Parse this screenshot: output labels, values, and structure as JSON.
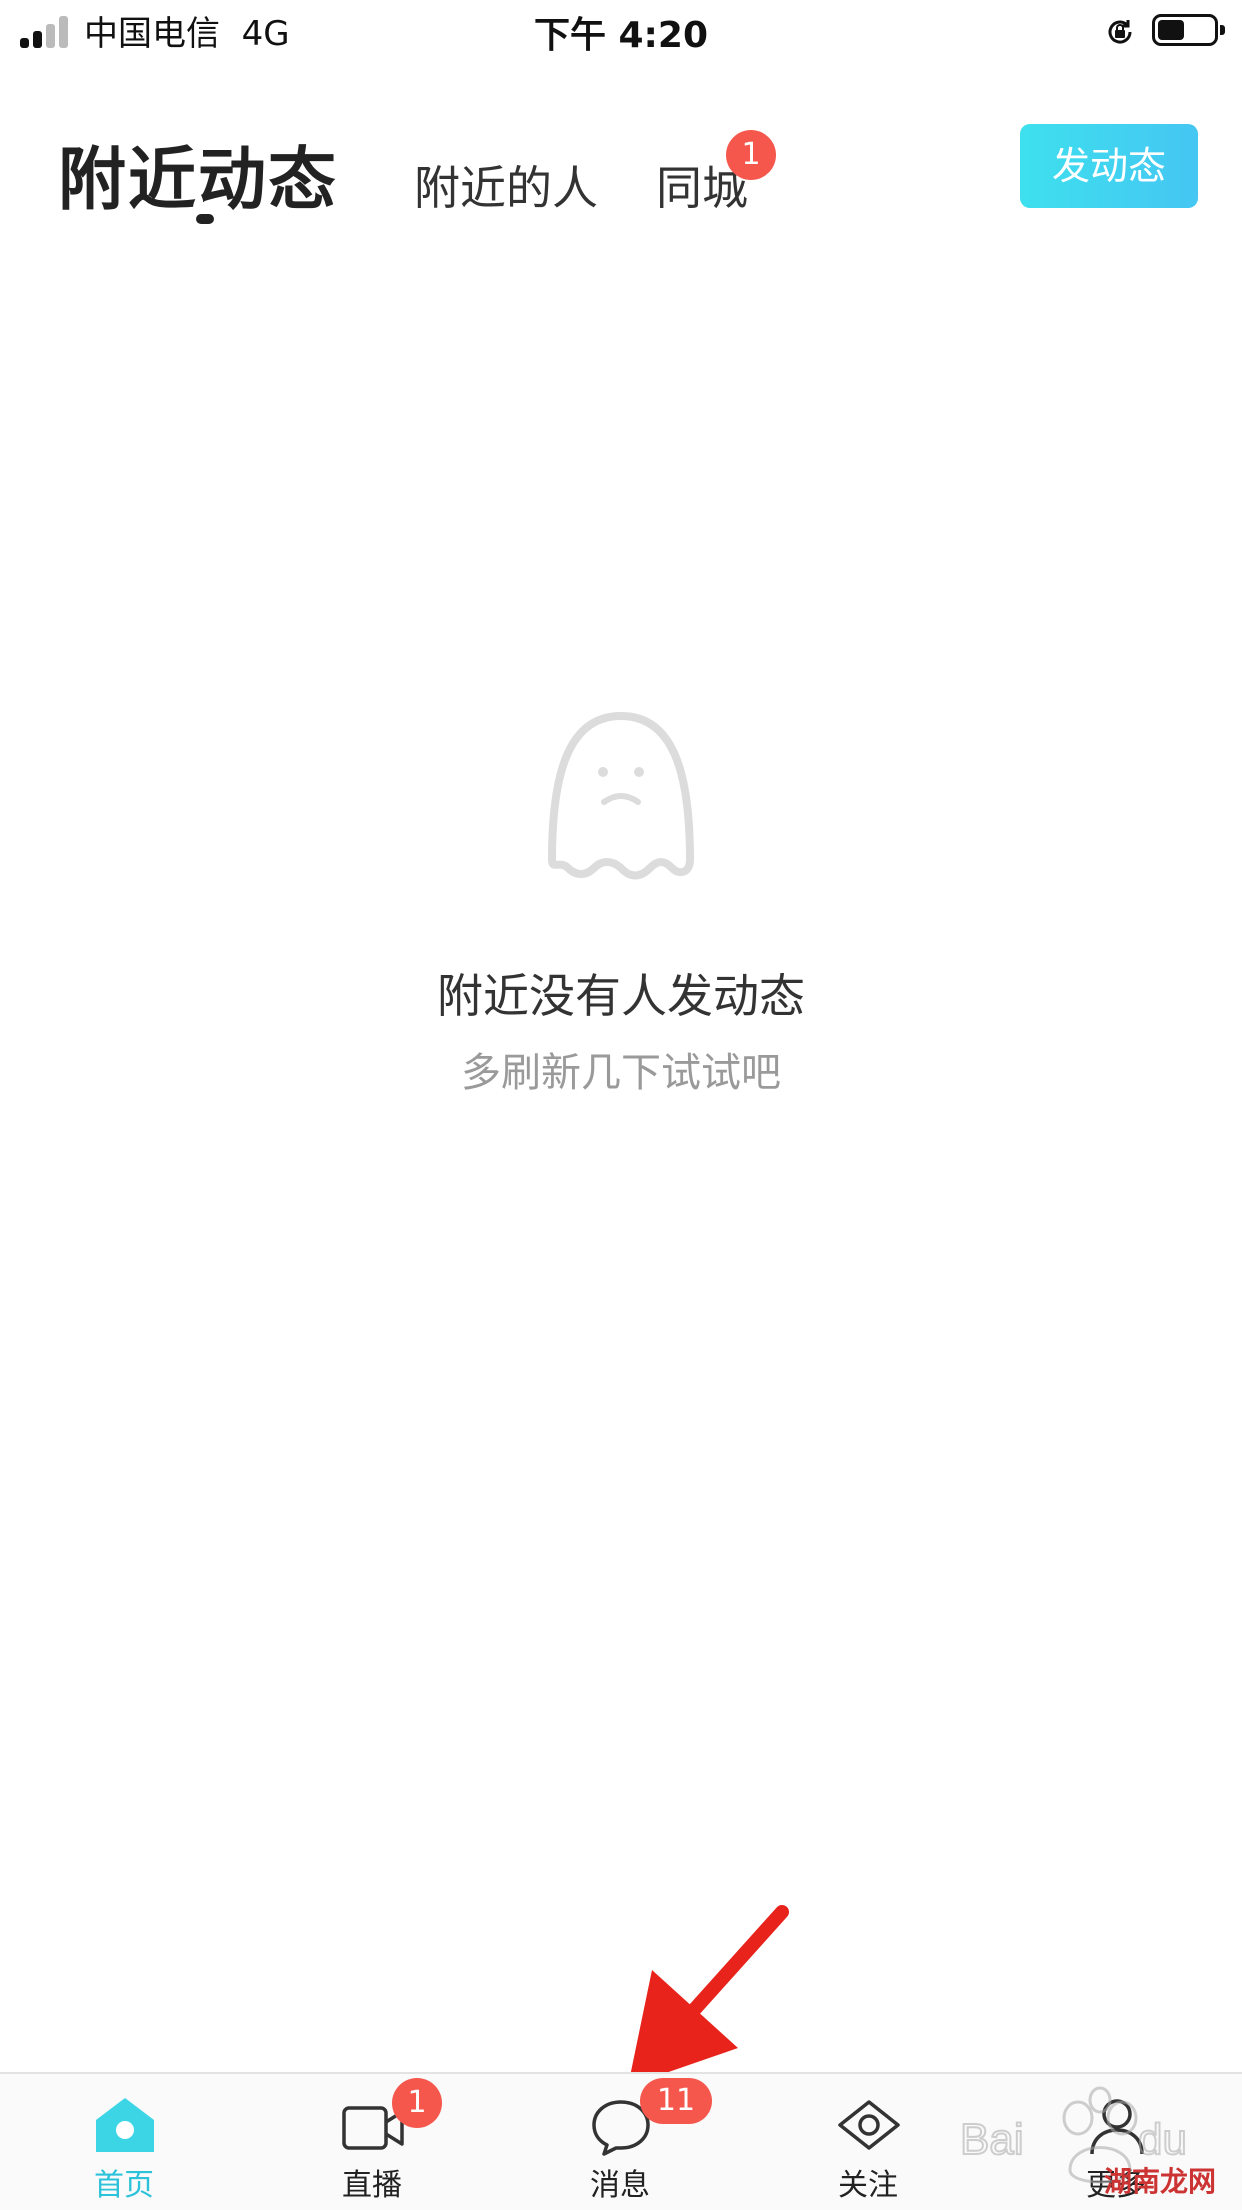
{
  "status_bar": {
    "carrier": "中国电信",
    "network": "4G",
    "time": "下午 4:20"
  },
  "top_nav": {
    "tabs": [
      {
        "label": "附近动态",
        "active": true
      },
      {
        "label": "附近的人",
        "active": false
      },
      {
        "label": "同城",
        "active": false,
        "badge": "1"
      }
    ],
    "post_button": "发动态"
  },
  "empty_state": {
    "icon": "ghost-icon",
    "title": "附近没有人发动态",
    "subtitle": "多刷新几下试试吧"
  },
  "bottom_tabs": [
    {
      "label": "首页",
      "icon": "home-icon",
      "active": true
    },
    {
      "label": "直播",
      "icon": "video-camera-icon",
      "badge": "1"
    },
    {
      "label": "消息",
      "icon": "chat-bubble-icon",
      "badge": "11"
    },
    {
      "label": "关注",
      "icon": "eye-icon"
    },
    {
      "label": "更多",
      "icon": "person-icon"
    }
  ],
  "watermark": {
    "text": "湖南龙网"
  },
  "colors": {
    "accent": "#2cc2d9",
    "badge": "#f5574d",
    "post_button": "#45c6f3",
    "annotation_arrow": "#e8231b"
  }
}
